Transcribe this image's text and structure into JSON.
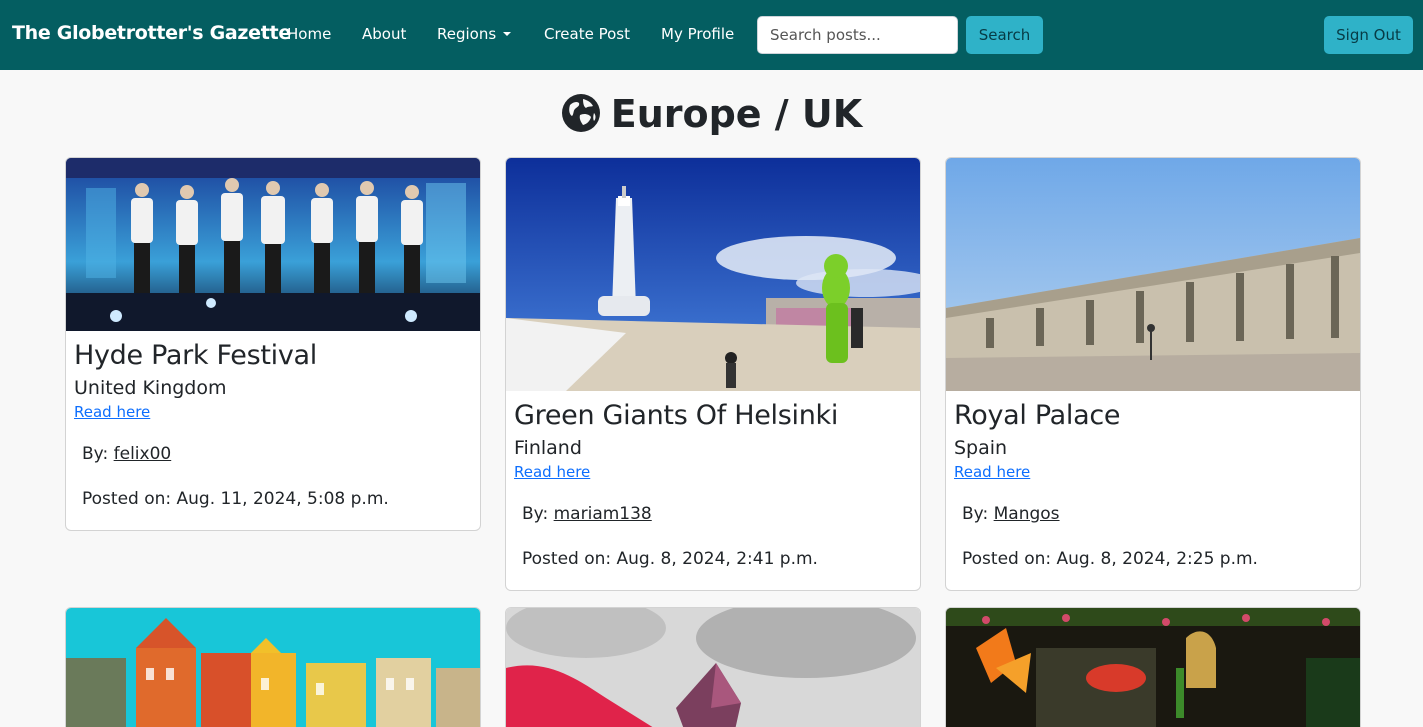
{
  "navbar": {
    "brand": "The Globetrotter's Gazette",
    "links": [
      "Home",
      "About",
      "Regions",
      "Create Post",
      "My Profile"
    ],
    "search_placeholder": "Search posts...",
    "search_button": "Search",
    "signout_button": "Sign Out"
  },
  "page": {
    "title": "Europe / UK",
    "title_icon": "globe-europe-icon"
  },
  "posts": [
    {
      "title": "Hyde Park Festival",
      "country": "United Kingdom",
      "read_label": "Read here",
      "by_label": "By:",
      "author": "felix00",
      "posted": "Posted on: Aug. 11, 2024, 5:08 p.m.",
      "image": "concert-stage-image"
    },
    {
      "title": "Green Giants Of Helsinki",
      "country": "Finland",
      "read_label": "Read here",
      "by_label": "By:",
      "author": "mariam138",
      "posted": "Posted on: Aug. 8, 2024, 2:41 p.m.",
      "image": "helsinki-statue-image"
    },
    {
      "title": "Royal Palace",
      "country": "Spain",
      "read_label": "Read here",
      "by_label": "By:",
      "author": "Mangos",
      "posted": "Posted on: Aug. 8, 2024, 2:25 p.m.",
      "image": "royal-palace-image"
    },
    {
      "image": "colorful-houses-image"
    },
    {
      "image": "gemstone-image"
    },
    {
      "image": "garden-display-image"
    }
  ],
  "colors": {
    "navbar": "#045e61",
    "button": "#2fb2c8",
    "link": "#0d6efd",
    "background": "#f8f8f8"
  }
}
